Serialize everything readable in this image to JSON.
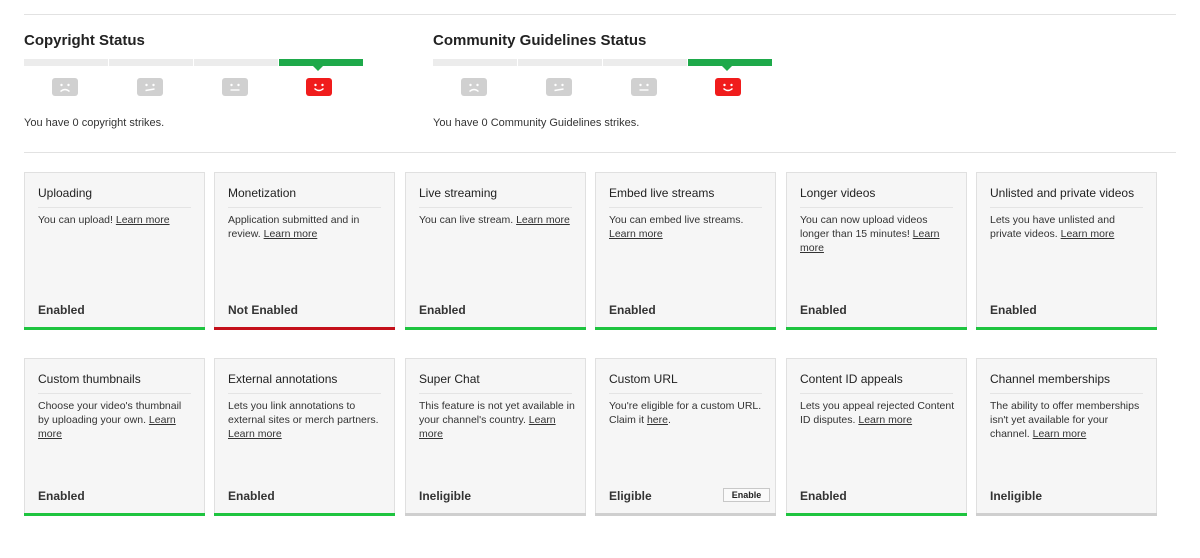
{
  "copyright": {
    "title": "Copyright Status",
    "status_text": "You have 0 copyright strikes.",
    "active_level": 4
  },
  "community": {
    "title": "Community Guidelines Status",
    "status_text": "You have 0 Community Guidelines strikes.",
    "active_level": 4
  },
  "colors": {
    "active_green": "#1ea94a",
    "enabled_bar": "#1ec43f",
    "not_enabled_bar": "#c4101a",
    "ineligible_bar": "#cfcfcf",
    "face_active": "#f01c1c",
    "face_inactive": "#d0d0d0"
  },
  "row1": [
    {
      "title": "Uploading",
      "desc": "You can upload!",
      "link": "Learn more",
      "status": "Enabled",
      "bar": "green"
    },
    {
      "title": "Monetization",
      "desc": "Application submitted and in review.",
      "link": "Learn more",
      "status": "Not Enabled",
      "bar": "red"
    },
    {
      "title": "Live streaming",
      "desc": "You can live stream.",
      "link": "Learn more",
      "status": "Enabled",
      "bar": "green"
    },
    {
      "title": "Embed live streams",
      "desc": "You can embed live streams.",
      "link": "Learn more",
      "status": "Enabled",
      "bar": "green"
    },
    {
      "title": "Longer videos",
      "desc": "You can now upload videos longer than 15 minutes!",
      "link": "Learn more",
      "status": "Enabled",
      "bar": "green"
    },
    {
      "title": "Unlisted and private videos",
      "desc": "Lets you have unlisted and private videos.",
      "link": "Learn more",
      "status": "Enabled",
      "bar": "green"
    }
  ],
  "row2": [
    {
      "title": "Custom thumbnails",
      "desc": "Choose your video's thumbnail by uploading your own.",
      "link": "Learn more",
      "status": "Enabled",
      "bar": "green"
    },
    {
      "title": "External annotations",
      "desc": "Lets you link annotations to external sites or merch partners.",
      "link": "Learn more",
      "status": "Enabled",
      "bar": "green"
    },
    {
      "title": "Super Chat",
      "desc": "This feature is not yet available in your channel's country.",
      "link": "Learn more",
      "status": "Ineligible",
      "bar": "grey"
    },
    {
      "title": "Custom URL",
      "desc": "You're eligible for a custom URL. Claim it",
      "link": "here",
      "suffix": ".",
      "status": "Eligible",
      "bar": "grey",
      "button": "Enable"
    },
    {
      "title": "Content ID appeals",
      "desc": "Lets you appeal rejected Content ID disputes.",
      "link": "Learn more",
      "status": "Enabled",
      "bar": "green"
    },
    {
      "title": "Channel memberships",
      "desc": "The ability to offer memberships isn't yet available for your channel.",
      "link": "Learn more",
      "status": "Ineligible",
      "bar": "grey"
    }
  ]
}
